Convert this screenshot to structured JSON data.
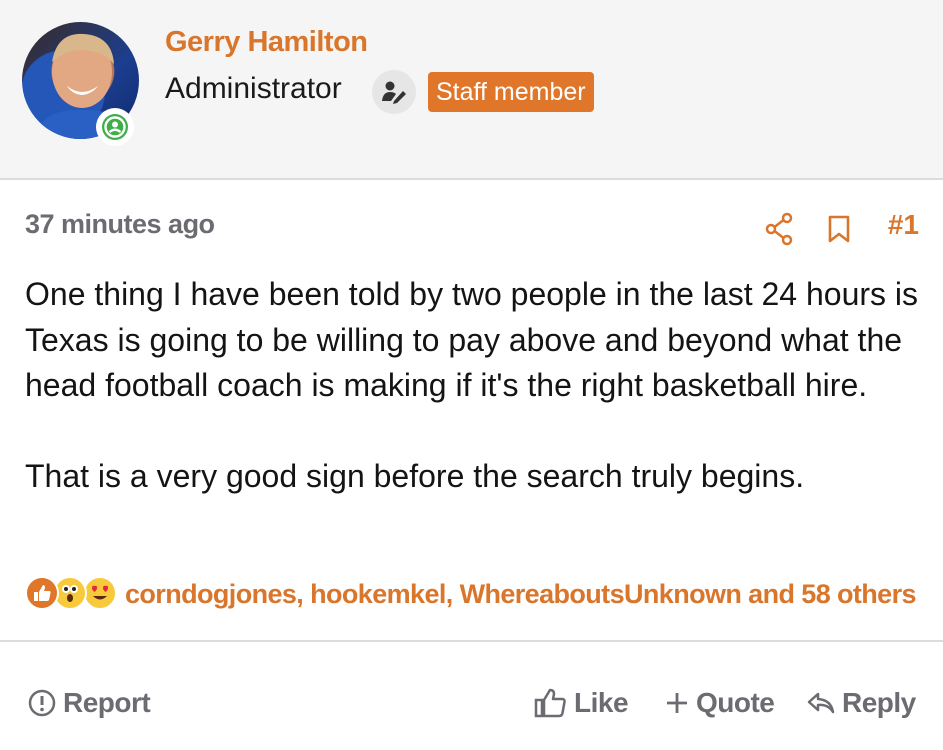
{
  "author": {
    "name": "Gerry Hamilton",
    "title": "Administrator",
    "badge": "Staff member",
    "online": true
  },
  "post": {
    "time": "37 minutes ago",
    "number": "#1",
    "paragraphs": [
      "One thing I have been told by two people in the last 24 hours is Texas is going to be willing to pay above and beyond what the head football coach is making if it's the right basketball hire.",
      "That is a very good sign before the search truly begins."
    ]
  },
  "reactions": {
    "icons": [
      "like-reaction-icon",
      "wow-reaction-icon",
      "love-reaction-icon"
    ],
    "summary": "corndogjones, hookemkel, WhereaboutsUnknown and 58 others"
  },
  "footer": {
    "report_label": "Report",
    "like_label": "Like",
    "quote_label": "Quote",
    "reply_label": "Reply"
  },
  "colors": {
    "accent": "#d9762b",
    "muted": "#6b6b72",
    "online": "#3fae49",
    "header_bg": "#f5f5f5"
  }
}
